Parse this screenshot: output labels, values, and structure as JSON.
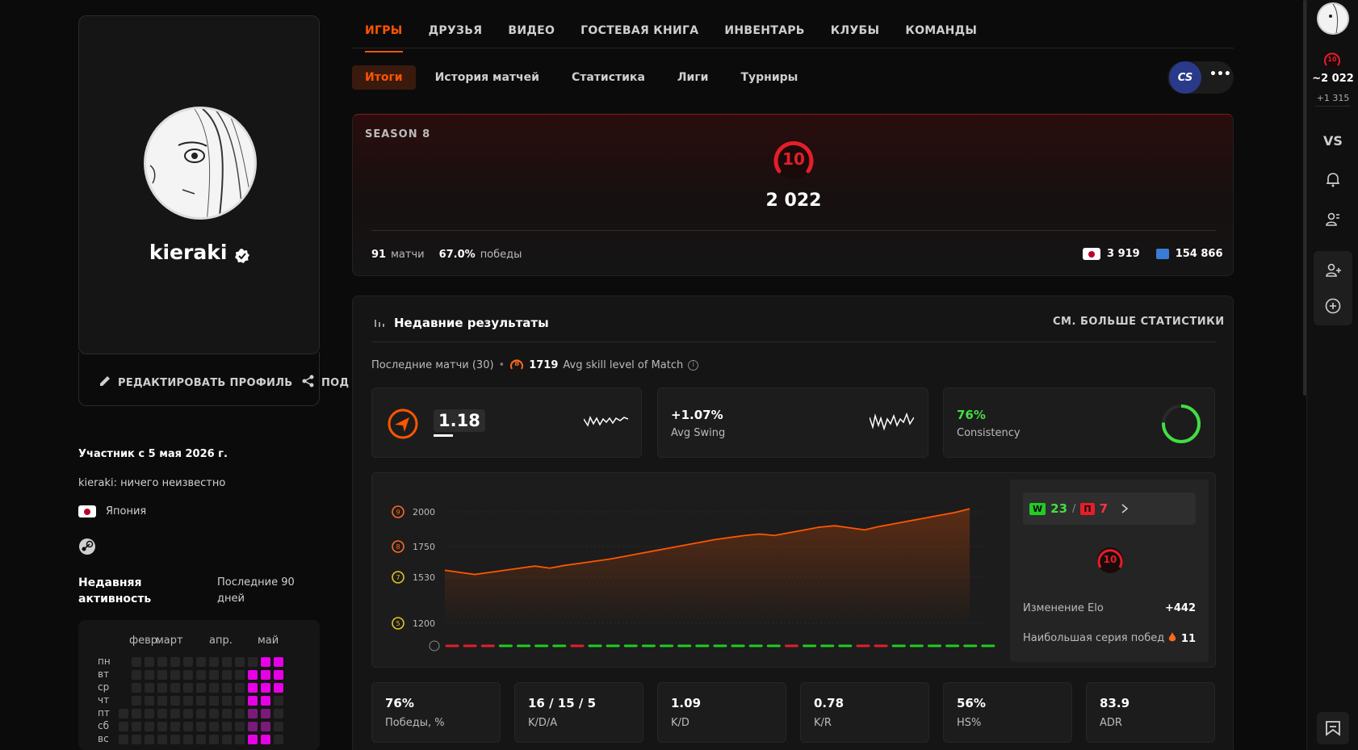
{
  "profile": {
    "username": "kieraki",
    "edit_label": "РЕДАКТИРОВАТЬ ПРОФИЛЬ",
    "share_label": "ПОД",
    "member_since": "Участник с 5 мая 2026 г.",
    "bio": "kieraki: ничего неизвестно",
    "country": "Япония",
    "activity_title": "Недавняя активность",
    "activity_period": "Последние 90 дней",
    "months": [
      "февр.",
      "март",
      "апр.",
      "май"
    ],
    "days": [
      "пн",
      "вт",
      "ср",
      "чт",
      "пт",
      "сб",
      "вс"
    ]
  },
  "nav": {
    "tabs": [
      "ИГРЫ",
      "ДРУЗЬЯ",
      "ВИДЕО",
      "ГОСТЕВАЯ КНИГА",
      "ИНВЕНТАРЬ",
      "КЛУБЫ",
      "КОМАНДЫ"
    ],
    "subtabs": [
      "Итоги",
      "История матчей",
      "Статистика",
      "Лиги",
      "Турниры"
    ],
    "game_badge": "CS",
    "more": "•••"
  },
  "season": {
    "label": "SEASON 8",
    "level": "10",
    "elo": "2 022",
    "matches_value": "91",
    "matches_label": "матчи",
    "wins_value": "67.0%",
    "wins_label": "победы",
    "rank_country": "3 919",
    "rank_region": "154 866"
  },
  "recent": {
    "title": "Недавние результаты",
    "more_stats": "СМ. БОЛЬШЕ СТАТИСТИКИ",
    "last_matches": "Последние матчи (30)",
    "avg_skill_level": "8",
    "avg_skill_value": "1719",
    "avg_skill_label": "Avg skill level of Match",
    "rating": "1.18",
    "swing_value": "+1.07%",
    "swing_label": "Avg Swing",
    "consistency_value": "76%",
    "consistency_label": "Consistency",
    "consistency_fraction": 0.76
  },
  "chart_data": {
    "type": "area",
    "y_ticks": [
      {
        "level": "9",
        "label": "2000",
        "value": 2000
      },
      {
        "level": "8",
        "label": "1750",
        "value": 1750
      },
      {
        "level": "7",
        "label": "1530",
        "value": 1530
      },
      {
        "level": "5",
        "label": "1200",
        "value": 1200
      }
    ],
    "ylim": [
      1200,
      2000
    ],
    "values": [
      1580,
      1565,
      1550,
      1565,
      1580,
      1595,
      1610,
      1595,
      1615,
      1630,
      1645,
      1660,
      1680,
      1700,
      1720,
      1740,
      1760,
      1780,
      1800,
      1815,
      1830,
      1840,
      1830,
      1850,
      1870,
      1890,
      1900,
      1885,
      1870,
      1895,
      1915,
      1935,
      1955,
      1975,
      1995,
      2022
    ],
    "results": [
      "L",
      "L",
      "L",
      "W",
      "W",
      "W",
      "W",
      "L",
      "W",
      "W",
      "W",
      "W",
      "W",
      "W",
      "W",
      "W",
      "W",
      "W",
      "W",
      "L",
      "W",
      "W",
      "W",
      "L",
      "L",
      "W",
      "W",
      "W",
      "W",
      "W",
      "W"
    ],
    "colors": {
      "line": "#ff5500",
      "win": "#22cc22",
      "loss": "#e51e2a"
    }
  },
  "summary": {
    "wins_label": "W",
    "wins": "23",
    "losses_label": "П",
    "losses": "7",
    "level": "10",
    "elo_change_label": "Изменение Elo",
    "elo_change": "+442",
    "streak_label": "Наибольшая серия побед",
    "streak": "11"
  },
  "stats": [
    {
      "value": "76%",
      "label": "Победы, %"
    },
    {
      "value": "16 / 15 / 5",
      "label": "K/D/A"
    },
    {
      "value": "1.09",
      "label": "K/D"
    },
    {
      "value": "0.78",
      "label": "K/R"
    },
    {
      "value": "56%",
      "label": "HS%"
    },
    {
      "value": "83.9",
      "label": "ADR"
    }
  ],
  "rail": {
    "level": "10",
    "elo": "~2 022",
    "elo_to_next": "+1 315",
    "vs": "VS"
  },
  "colors": {
    "accent": "#ff5500",
    "level_red": "#e51e2a",
    "heat": "#e600e6"
  }
}
